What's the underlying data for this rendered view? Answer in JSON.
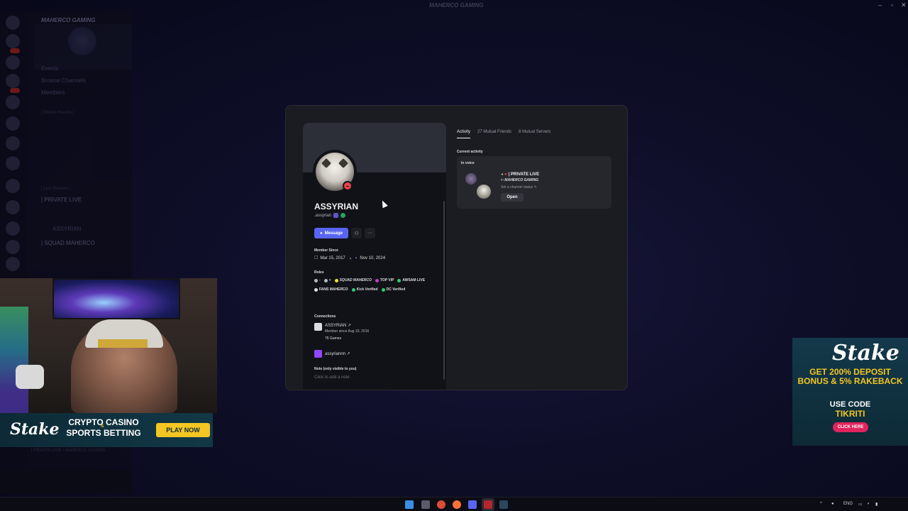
{
  "window": {
    "title": "MAHERCO GAMING"
  },
  "server": {
    "name": "MAHERCO GAMING",
    "nav": [
      "Events",
      "Browse Channels",
      "Members"
    ],
    "categories": [
      "| Private Rooms |",
      "| Live Streams |"
    ],
    "channels": [
      "| PRIVATE LIVE",
      "ASSYRIAN",
      "| SQUAD MAHERCO"
    ],
    "voice_footer": "| PRIVATE LIVE / MAHERCO GAMING"
  },
  "profile": {
    "display_name": "ASSYRIAN",
    "username": ".assyrian",
    "message_label": "Message",
    "member_since_label": "Member Since",
    "discord_since": "Mar 15, 2017",
    "server_since": "Nov 10, 2024",
    "roles_label": "Roles",
    "roles": [
      {
        "name": "-",
        "color": "#b5bac1",
        "italic": false
      },
      {
        "name": "+",
        "color": "#b5bac1",
        "italic": false
      },
      {
        "name": "SQUAD MAHERCO",
        "color": "#f0e130",
        "italic": true
      },
      {
        "name": "TOP VIP",
        "color": "#c33bd0",
        "italic": false
      },
      {
        "name": "AWSAM LIVE",
        "color": "#2ecc71",
        "italic": false
      },
      {
        "name": "FANS MAHERCO",
        "color": "#dbdee1",
        "italic": false
      },
      {
        "name": "Kick Verified",
        "color": "#2ecc71",
        "italic": false
      },
      {
        "name": "DC Verified",
        "color": "#2ecc71",
        "italic": false
      }
    ],
    "connections_label": "Connections",
    "connections": [
      {
        "name": "ASSYRIAN ↗",
        "sub": "Member since Aug 10, 2016",
        "sub2": "76 Games",
        "icon": "steam-icon",
        "color": "#dbdee1"
      },
      {
        "name": "assyriannn ↗",
        "sub": "",
        "sub2": "",
        "icon": "twitch-icon",
        "color": "#9146ff"
      }
    ],
    "note_label": "Note (only visible to you)",
    "note_placeholder": "Click to add a note"
  },
  "tabs": [
    "Activity",
    "27 Mutual Friends",
    "8 Mutual Servers"
  ],
  "activity": {
    "label": "Current activity",
    "in_voice": "In voice",
    "channel": "| PRIVATE LIVE",
    "in_prefix": "in",
    "server": "MAHERCO GAMING",
    "status": "Set a channel status",
    "open_label": "Open"
  },
  "ads": {
    "brand": "Stake",
    "bottom_line1": "CRYPTO CASINO",
    "bottom_amp": "&",
    "bottom_line2": "SPORTS BETTING",
    "play_now": "PLAY NOW",
    "right_promo": "GET 200% DEPOSIT BONUS & 5% RAKEBACK",
    "right_use": "USE CODE",
    "right_code": "TIKRITI",
    "right_click": "CLICK HERE"
  },
  "taskbar": {
    "lang": "ENG"
  }
}
